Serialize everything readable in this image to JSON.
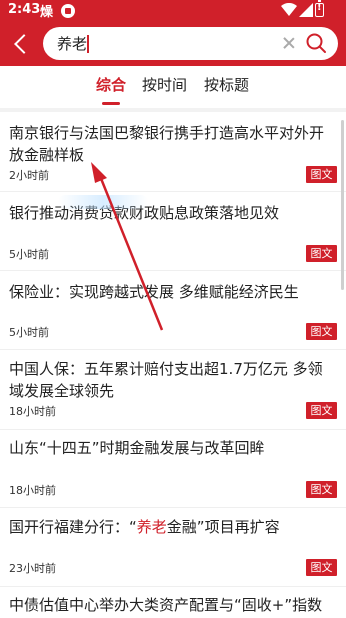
{
  "status_bar": {
    "time": "2:43",
    "flame_glyph": "燥"
  },
  "search": {
    "query": "养老"
  },
  "tabs": [
    {
      "label": "综合",
      "active": true
    },
    {
      "label": "按时间",
      "active": false
    },
    {
      "label": "按标题",
      "active": false
    }
  ],
  "news": [
    {
      "title": "南京银行与法国巴黎银行携手打造高水平对外开放金融样板",
      "time": "2小时前",
      "badge": "图文"
    },
    {
      "title": "银行推动消费贷款财政贴息政策落地见效",
      "time": "5小时前",
      "badge": "图文"
    },
    {
      "title": "保险业：实现跨越式发展 多维赋能经济民生",
      "time": "5小时前",
      "badge": "图文"
    },
    {
      "title": "中国人保：五年累计赔付支出超1.7万亿元 多领域发展全球领先",
      "time": "18小时前",
      "badge": "图文"
    },
    {
      "title": "山东“十四五”时期金融发展与改革回眸",
      "time": "18小时前",
      "badge": "图文"
    },
    {
      "title_before": "国开行福建分行：“",
      "title_highlight": "养老",
      "title_after": "金融”项目再扩容",
      "time": "23小时前",
      "badge": "图文"
    },
    {
      "title": "中债估值中心举办大类资产配置与“固收+”指数"
    }
  ],
  "colors": {
    "accent": "#d0202a",
    "annotation_arrow": "#d0202a"
  }
}
